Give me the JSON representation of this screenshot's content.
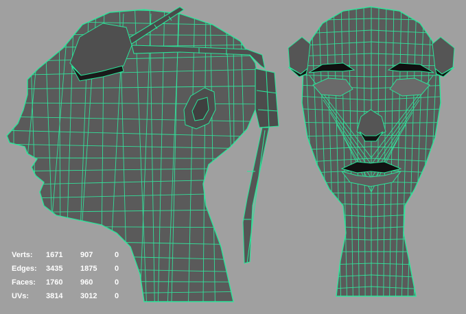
{
  "viewport": {
    "background": "#a0a0a0",
    "mesh_fill": "#5a5a5a",
    "wire_color": "#33e09a",
    "objects": [
      {
        "name": "head-side-view",
        "icon": "head-profile-mesh"
      },
      {
        "name": "head-front-view",
        "icon": "head-front-mesh"
      }
    ]
  },
  "hud": {
    "rows": [
      {
        "label": "Verts:",
        "values": [
          "1671",
          "907",
          "0"
        ]
      },
      {
        "label": "Edges:",
        "values": [
          "3435",
          "1875",
          "0"
        ]
      },
      {
        "label": "Faces:",
        "values": [
          "1760",
          "960",
          "0"
        ]
      },
      {
        "label": "UVs:",
        "values": [
          "3814",
          "3012",
          "0"
        ]
      }
    ]
  }
}
